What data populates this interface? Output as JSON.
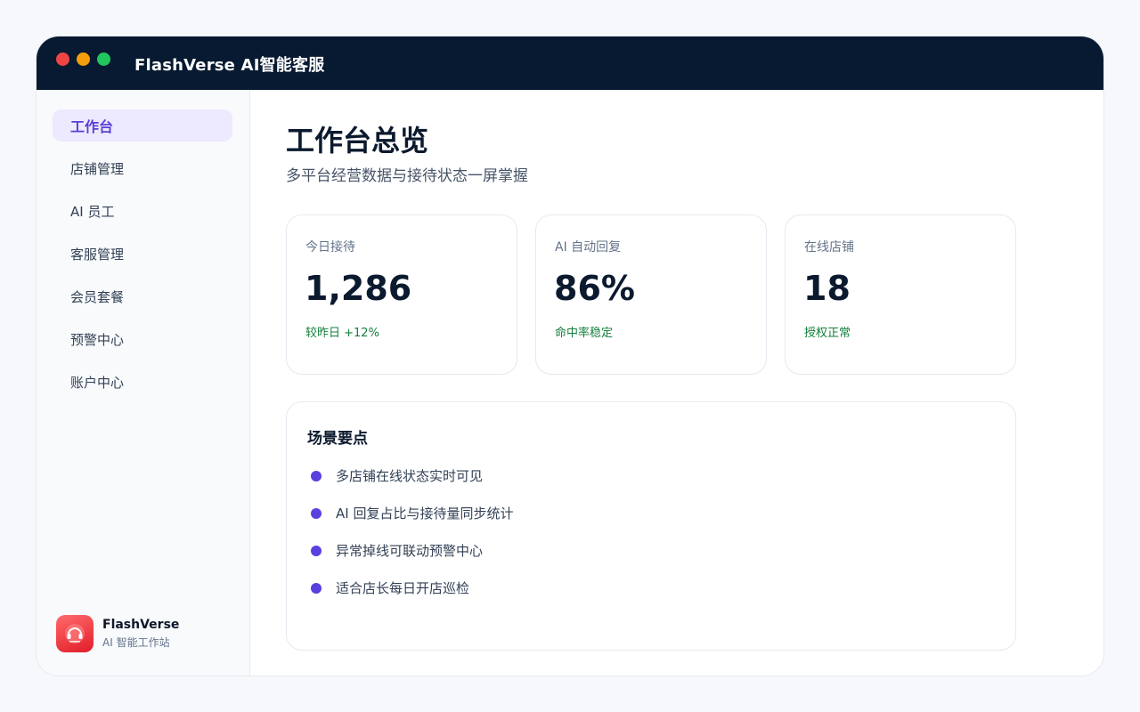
{
  "app": {
    "title": "FlashVerse AI智能客服"
  },
  "colors": {
    "accent": "#5b3fd6",
    "titlebar": "#071a31",
    "positive": "#15803d",
    "bullet": "#5b3fe0"
  },
  "sidebar": {
    "items": [
      {
        "label": "工作台",
        "active": true
      },
      {
        "label": "店铺管理",
        "active": false
      },
      {
        "label": "AI 员工",
        "active": false
      },
      {
        "label": "客服管理",
        "active": false
      },
      {
        "label": "会员套餐",
        "active": false
      },
      {
        "label": "预警中心",
        "active": false
      },
      {
        "label": "账户中心",
        "active": false
      }
    ],
    "brand": {
      "name": "FlashVerse",
      "subtitle": "AI 智能工作站",
      "logo_icon": "headset-icon"
    }
  },
  "main": {
    "title": "工作台总览",
    "subtitle": "多平台经营数据与接待状态一屏掌握",
    "stats": [
      {
        "label": "今日接待",
        "value": "1,286",
        "note": "较昨日 +12%"
      },
      {
        "label": "AI 自动回复",
        "value": "86%",
        "note": "命中率稳定"
      },
      {
        "label": "在线店铺",
        "value": "18",
        "note": "授权正常"
      }
    ],
    "scene": {
      "title": "场景要点",
      "items": [
        "多店铺在线状态实时可见",
        "AI 回复占比与接待量同步统计",
        "异常掉线可联动预警中心",
        "适合店长每日开店巡检"
      ]
    }
  }
}
